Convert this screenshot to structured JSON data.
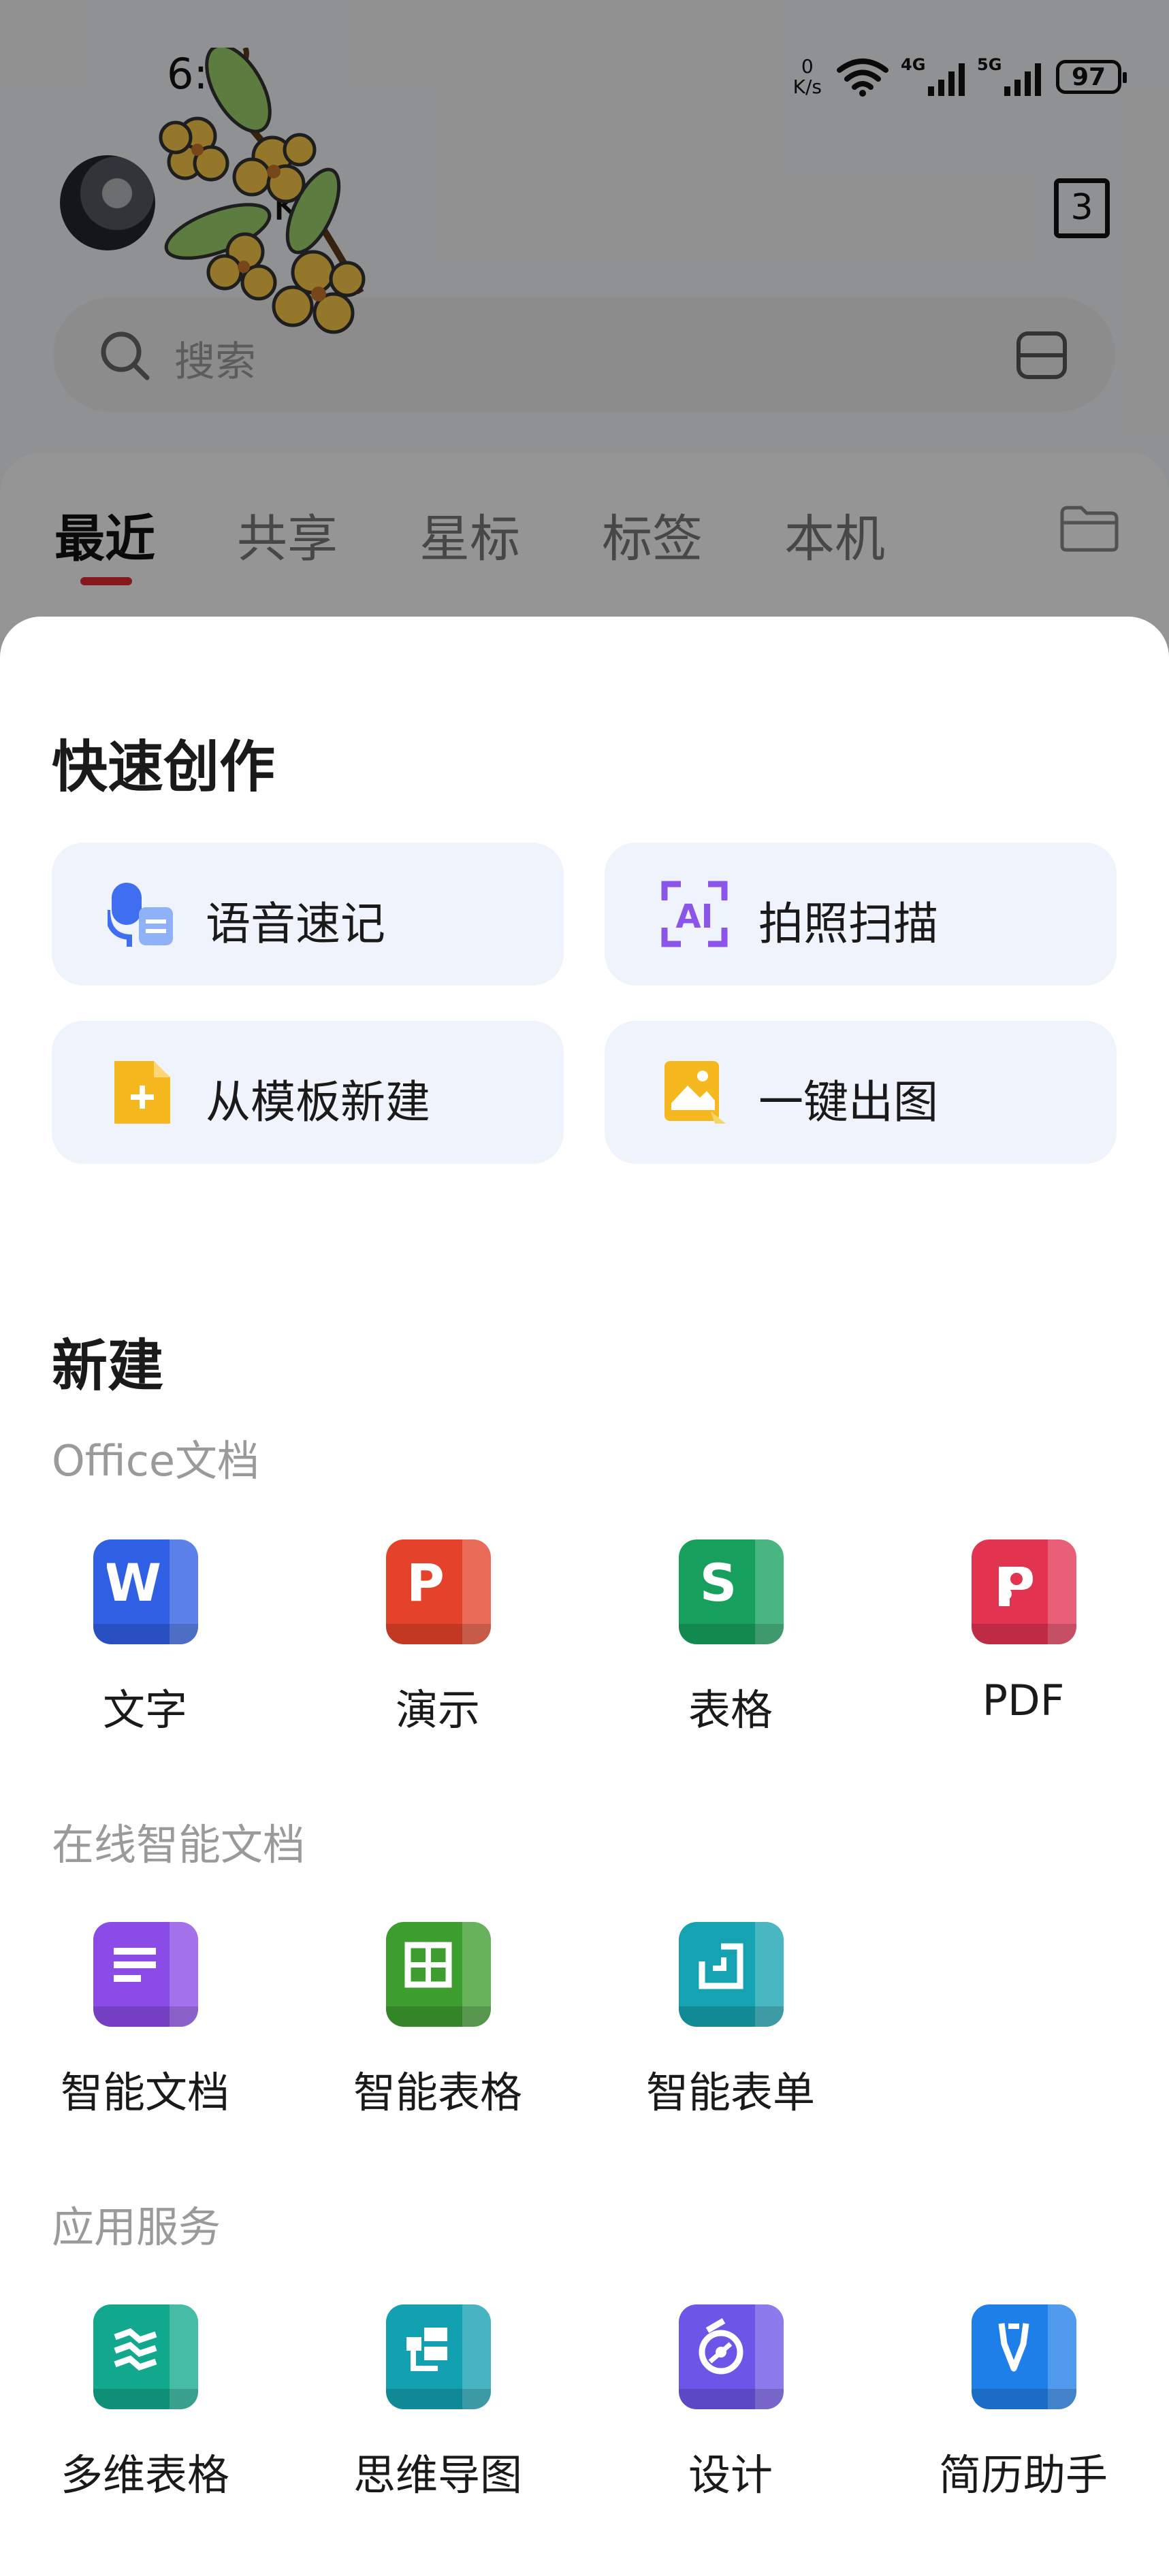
{
  "status_bar": {
    "time": "6:0",
    "net_speed_value": "0",
    "net_speed_unit": "K/s",
    "signal1_label": "4G",
    "signal2_label": "5G",
    "battery": "97"
  },
  "header": {
    "username": "k",
    "tab_count": "3",
    "search_placeholder": "搜索"
  },
  "tabs": [
    {
      "label": "最近",
      "active": true
    },
    {
      "label": "共享",
      "active": false
    },
    {
      "label": "星标",
      "active": false
    },
    {
      "label": "标签",
      "active": false
    },
    {
      "label": "本机",
      "active": false
    }
  ],
  "quick_create": {
    "title": "快速创作",
    "items": [
      {
        "label": "语音速记",
        "icon": "voice-note-icon"
      },
      {
        "label": "拍照扫描",
        "icon": "ai-scan-icon"
      },
      {
        "label": "从模板新建",
        "icon": "template-icon"
      },
      {
        "label": "一键出图",
        "icon": "image-generate-icon"
      }
    ]
  },
  "new": {
    "title": "新建",
    "sections": [
      {
        "title": "Office文档",
        "items": [
          {
            "label": "文字",
            "icon": "writer-icon",
            "color": "#2f5fe3"
          },
          {
            "label": "演示",
            "icon": "presentation-icon",
            "color": "#e4422a"
          },
          {
            "label": "表格",
            "icon": "spreadsheet-icon",
            "color": "#17a05d"
          },
          {
            "label": "PDF",
            "icon": "pdf-icon",
            "color": "#e23351"
          }
        ]
      },
      {
        "title": "在线智能文档",
        "items": [
          {
            "label": "智能文档",
            "icon": "smart-doc-icon",
            "color": "#8a4be6"
          },
          {
            "label": "智能表格",
            "icon": "smart-sheet-icon",
            "color": "#3d9d2e"
          },
          {
            "label": "智能表单",
            "icon": "smart-form-icon",
            "color": "#16a3b1"
          }
        ]
      },
      {
        "title": "应用服务",
        "items": [
          {
            "label": "多维表格",
            "icon": "multi-table-icon",
            "color": "#12a88e"
          },
          {
            "label": "思维导图",
            "icon": "mind-map-icon",
            "color": "#13a0b0"
          },
          {
            "label": "设计",
            "icon": "design-icon",
            "color": "#6d55e8"
          },
          {
            "label": "简历助手",
            "icon": "resume-icon",
            "color": "#1f7fe8"
          }
        ]
      }
    ]
  }
}
